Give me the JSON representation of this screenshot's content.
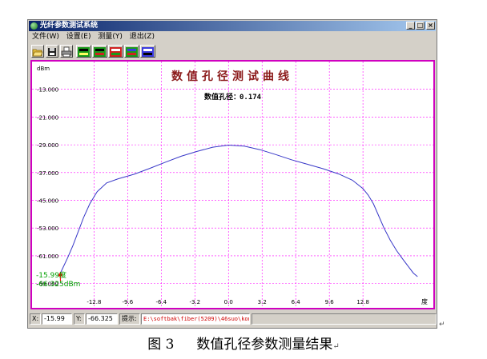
{
  "window": {
    "title": "光纤参数测试系统",
    "controls": [
      "_",
      "□",
      "×"
    ]
  },
  "menu": {
    "items": [
      "文件(W)",
      "设置(E)",
      "测量(Y)",
      "退出(Z)"
    ]
  },
  "toolbar": {
    "icons": [
      "open-folder-icon",
      "save-disk-icon",
      "print-icon",
      "measure-1-icon",
      "measure-2-icon",
      "measure-3-icon",
      "measure-4-icon",
      "measure-5-icon"
    ],
    "colors": [
      "#1a9a1a",
      "#1a9a1a",
      "#d02020",
      "#1a9a1a",
      "#3a3adf"
    ]
  },
  "plot": {
    "title": "数值孔径测试曲线",
    "na_label": "数值孔径：",
    "na_value": "0.174",
    "readout_deg": "-15.99度",
    "readout_dbm": "-66.325dBm",
    "colors": {
      "frame": "#d000c0",
      "grid": "#ff00ff",
      "curve": "#3838c8",
      "title": "#8b1a1a",
      "readout": "#00a000",
      "marker": "#ff0000"
    }
  },
  "chart_data": {
    "type": "line",
    "title": "数值孔径测试曲线",
    "xlabel": "度",
    "ylabel": "dBm",
    "xlim": [
      -18.7,
      19.5
    ],
    "ylim": [
      -76,
      -5
    ],
    "x_ticks": [
      "-12.8",
      "-9.6",
      "-6.4",
      "-3.2",
      "0.0",
      "3.2",
      "6.4",
      "9.6",
      "12.8"
    ],
    "y_ticks": [
      "-13.000",
      "-21.000",
      "-29.000",
      "-37.000",
      "-45.000",
      "-53.000",
      "-61.000",
      "-69.000"
    ],
    "grid": true,
    "series": [
      {
        "x": [
          -16.0,
          -15.3,
          -14.8,
          -14.3,
          -13.8,
          -13.2,
          -12.5,
          -11.6,
          -10.5,
          -9.0,
          -7.5,
          -6.0,
          -4.5,
          -3.0,
          -1.5,
          0.0,
          1.5,
          3.0,
          4.5,
          6.0,
          7.5,
          9.0,
          10.5,
          11.8,
          12.8,
          13.3,
          13.8,
          14.3,
          14.8,
          15.4,
          16.0,
          16.6,
          17.1,
          17.6,
          18.0
        ],
        "y": [
          -66.0,
          -61.5,
          -58.0,
          -54.0,
          -50.0,
          -46.0,
          -42.5,
          -40.0,
          -38.8,
          -37.5,
          -35.8,
          -34.0,
          -32.3,
          -30.9,
          -29.7,
          -29.1,
          -29.4,
          -30.4,
          -31.8,
          -33.3,
          -34.6,
          -35.9,
          -37.4,
          -39.2,
          -41.6,
          -43.5,
          -46.0,
          -49.5,
          -53.0,
          -56.5,
          -59.5,
          -62.0,
          -64.0,
          -66.0,
          -67.0
        ]
      }
    ]
  },
  "status": {
    "x_label": "X:",
    "x_value": "-15.99",
    "y_label": "Y:",
    "y_value": "-66.325",
    "hint_label": "提示:",
    "hint_value": "E:\\softbak\\fiber(5209)\\46suo\\kong.dat"
  },
  "caption": {
    "number": "图 3",
    "text": "数值孔径参数测量结果"
  }
}
